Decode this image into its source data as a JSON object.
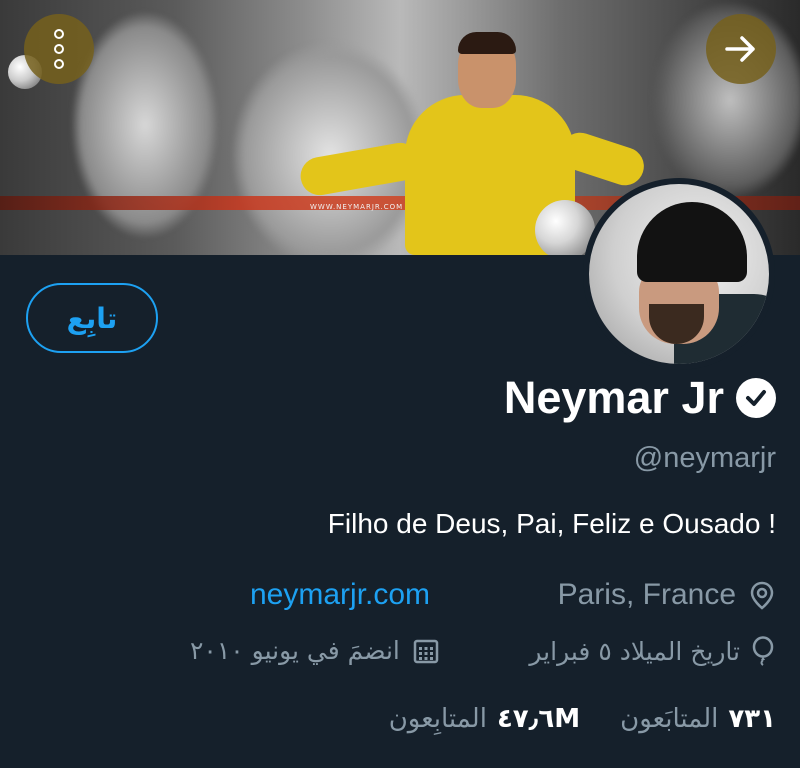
{
  "banner": {
    "watermark": "WWW.NEYMARJR.COM"
  },
  "actions": {
    "follow_label": "تابِع"
  },
  "profile": {
    "name": "Neymar Jr",
    "handle": "@neymarjr",
    "bio": "Filho de Deus, Pai, Feliz e Ousado !",
    "website": "neymarjr.com",
    "location": "Paris, France",
    "birthday": "تاريخ الميلاد ٥ فبراير",
    "joined": "انضمَ في يونيو ٢٠١٠"
  },
  "stats": {
    "following_count": "٧٣١",
    "following_label": "المتابَعون",
    "followers_count": "٤٧٫٦M",
    "followers_label": "المتابِعون"
  },
  "icons": {
    "more": "more-vertical-icon",
    "next": "arrow-right-icon",
    "verified": "verified-badge-icon",
    "location": "location-pin-icon",
    "birthday": "balloon-icon",
    "joined": "calendar-icon"
  },
  "colors": {
    "background": "#15202b",
    "accent": "#1da1f2",
    "muted": "#8899a6",
    "overlay_button": "#76601c"
  }
}
